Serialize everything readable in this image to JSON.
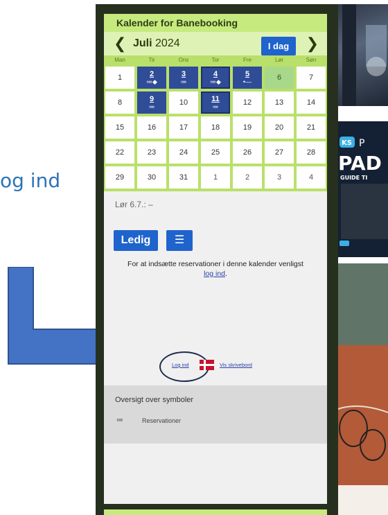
{
  "left_text": "og ind",
  "calendar": {
    "header_title": "Kalender for Banebooking",
    "month_name": "Juli",
    "year": "2024",
    "today_button": "I dag",
    "prev_icon": "chevron-left-icon",
    "next_icon": "chevron-right-icon",
    "weekdays": [
      "Man",
      "Tir",
      "Ons",
      "Tor",
      "Fre",
      "Lør",
      "Søn"
    ],
    "weeks": [
      [
        {
          "day": "1",
          "state": "normal"
        },
        {
          "day": "2",
          "state": "booked",
          "symbol": "≔◆"
        },
        {
          "day": "3",
          "state": "booked",
          "symbol": "≔"
        },
        {
          "day": "4",
          "state": "booked-selected",
          "symbol": "≔◆"
        },
        {
          "day": "5",
          "state": "booked",
          "symbol": "•—"
        },
        {
          "day": "6",
          "state": "today"
        },
        {
          "day": "7",
          "state": "normal"
        }
      ],
      [
        {
          "day": "8",
          "state": "normal"
        },
        {
          "day": "9",
          "state": "booked",
          "symbol": "≔"
        },
        {
          "day": "10",
          "state": "normal"
        },
        {
          "day": "11",
          "state": "booked-selected",
          "symbol": "≔"
        },
        {
          "day": "12",
          "state": "normal"
        },
        {
          "day": "13",
          "state": "normal"
        },
        {
          "day": "14",
          "state": "normal"
        }
      ],
      [
        {
          "day": "15",
          "state": "normal"
        },
        {
          "day": "16",
          "state": "normal"
        },
        {
          "day": "17",
          "state": "normal"
        },
        {
          "day": "18",
          "state": "normal"
        },
        {
          "day": "19",
          "state": "normal"
        },
        {
          "day": "20",
          "state": "normal"
        },
        {
          "day": "21",
          "state": "normal"
        }
      ],
      [
        {
          "day": "22",
          "state": "normal"
        },
        {
          "day": "23",
          "state": "normal"
        },
        {
          "day": "24",
          "state": "normal"
        },
        {
          "day": "25",
          "state": "normal"
        },
        {
          "day": "26",
          "state": "normal"
        },
        {
          "day": "27",
          "state": "normal"
        },
        {
          "day": "28",
          "state": "normal"
        }
      ],
      [
        {
          "day": "29",
          "state": "normal"
        },
        {
          "day": "30",
          "state": "normal"
        },
        {
          "day": "31",
          "state": "normal"
        },
        {
          "day": "1",
          "state": "other"
        },
        {
          "day": "2",
          "state": "other"
        },
        {
          "day": "3",
          "state": "other"
        },
        {
          "day": "4",
          "state": "other"
        }
      ]
    ],
    "status_line": "Lør 6.7.: –",
    "ledig_button": "Ledig",
    "list_button_icon": "list-icon",
    "hint_text": "For at indsætte reservationer i denne kalender venligst",
    "hint_link": "log ind",
    "hint_suffix": ".",
    "login_link": "Log ind",
    "flag_icon": "danish-flag-icon",
    "desk_link": "Vis skrivebord",
    "legend_title": "Oversigt over symboler",
    "legend_symbol": "≔",
    "legend_label": "Reservationer"
  },
  "colors": {
    "accent_blue": "#1f63cc",
    "booked_blue": "#2f4c97",
    "calendar_green": "#c6ea7e",
    "frame_dark": "#27301f",
    "arrow_blue": "#4472c4"
  }
}
